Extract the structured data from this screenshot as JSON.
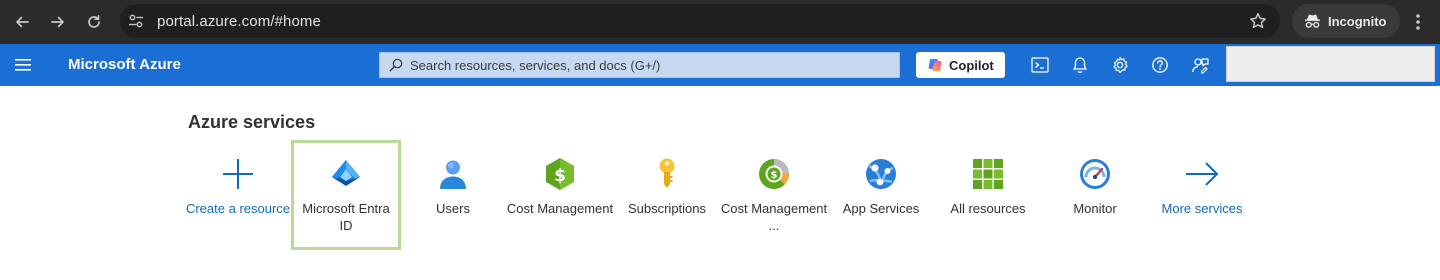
{
  "browser": {
    "url": "portal.azure.com/#home",
    "incognito_label": "Incognito"
  },
  "topbar": {
    "brand": "Microsoft Azure",
    "search_placeholder": "Search resources, services, and docs (G+/)",
    "copilot_label": "Copilot",
    "accent_color": "#1b6fd4"
  },
  "services": {
    "title": "Azure services",
    "tiles": [
      {
        "label": "Create a resource",
        "icon": "plus-icon",
        "link": true
      },
      {
        "label": "Microsoft Entra ID",
        "icon": "entra-id-icon",
        "selected": true
      },
      {
        "label": "Users",
        "icon": "users-icon"
      },
      {
        "label": "Cost Management",
        "icon": "cost-management-icon"
      },
      {
        "label": "Subscriptions",
        "icon": "key-icon"
      },
      {
        "label": "Cost Management ...",
        "icon": "cost-analysis-icon"
      },
      {
        "label": "App Services",
        "icon": "app-services-icon"
      },
      {
        "label": "All resources",
        "icon": "grid-icon"
      },
      {
        "label": "Monitor",
        "icon": "monitor-gauge-icon"
      },
      {
        "label": "More services",
        "icon": "arrow-right-icon",
        "link": true
      }
    ]
  }
}
